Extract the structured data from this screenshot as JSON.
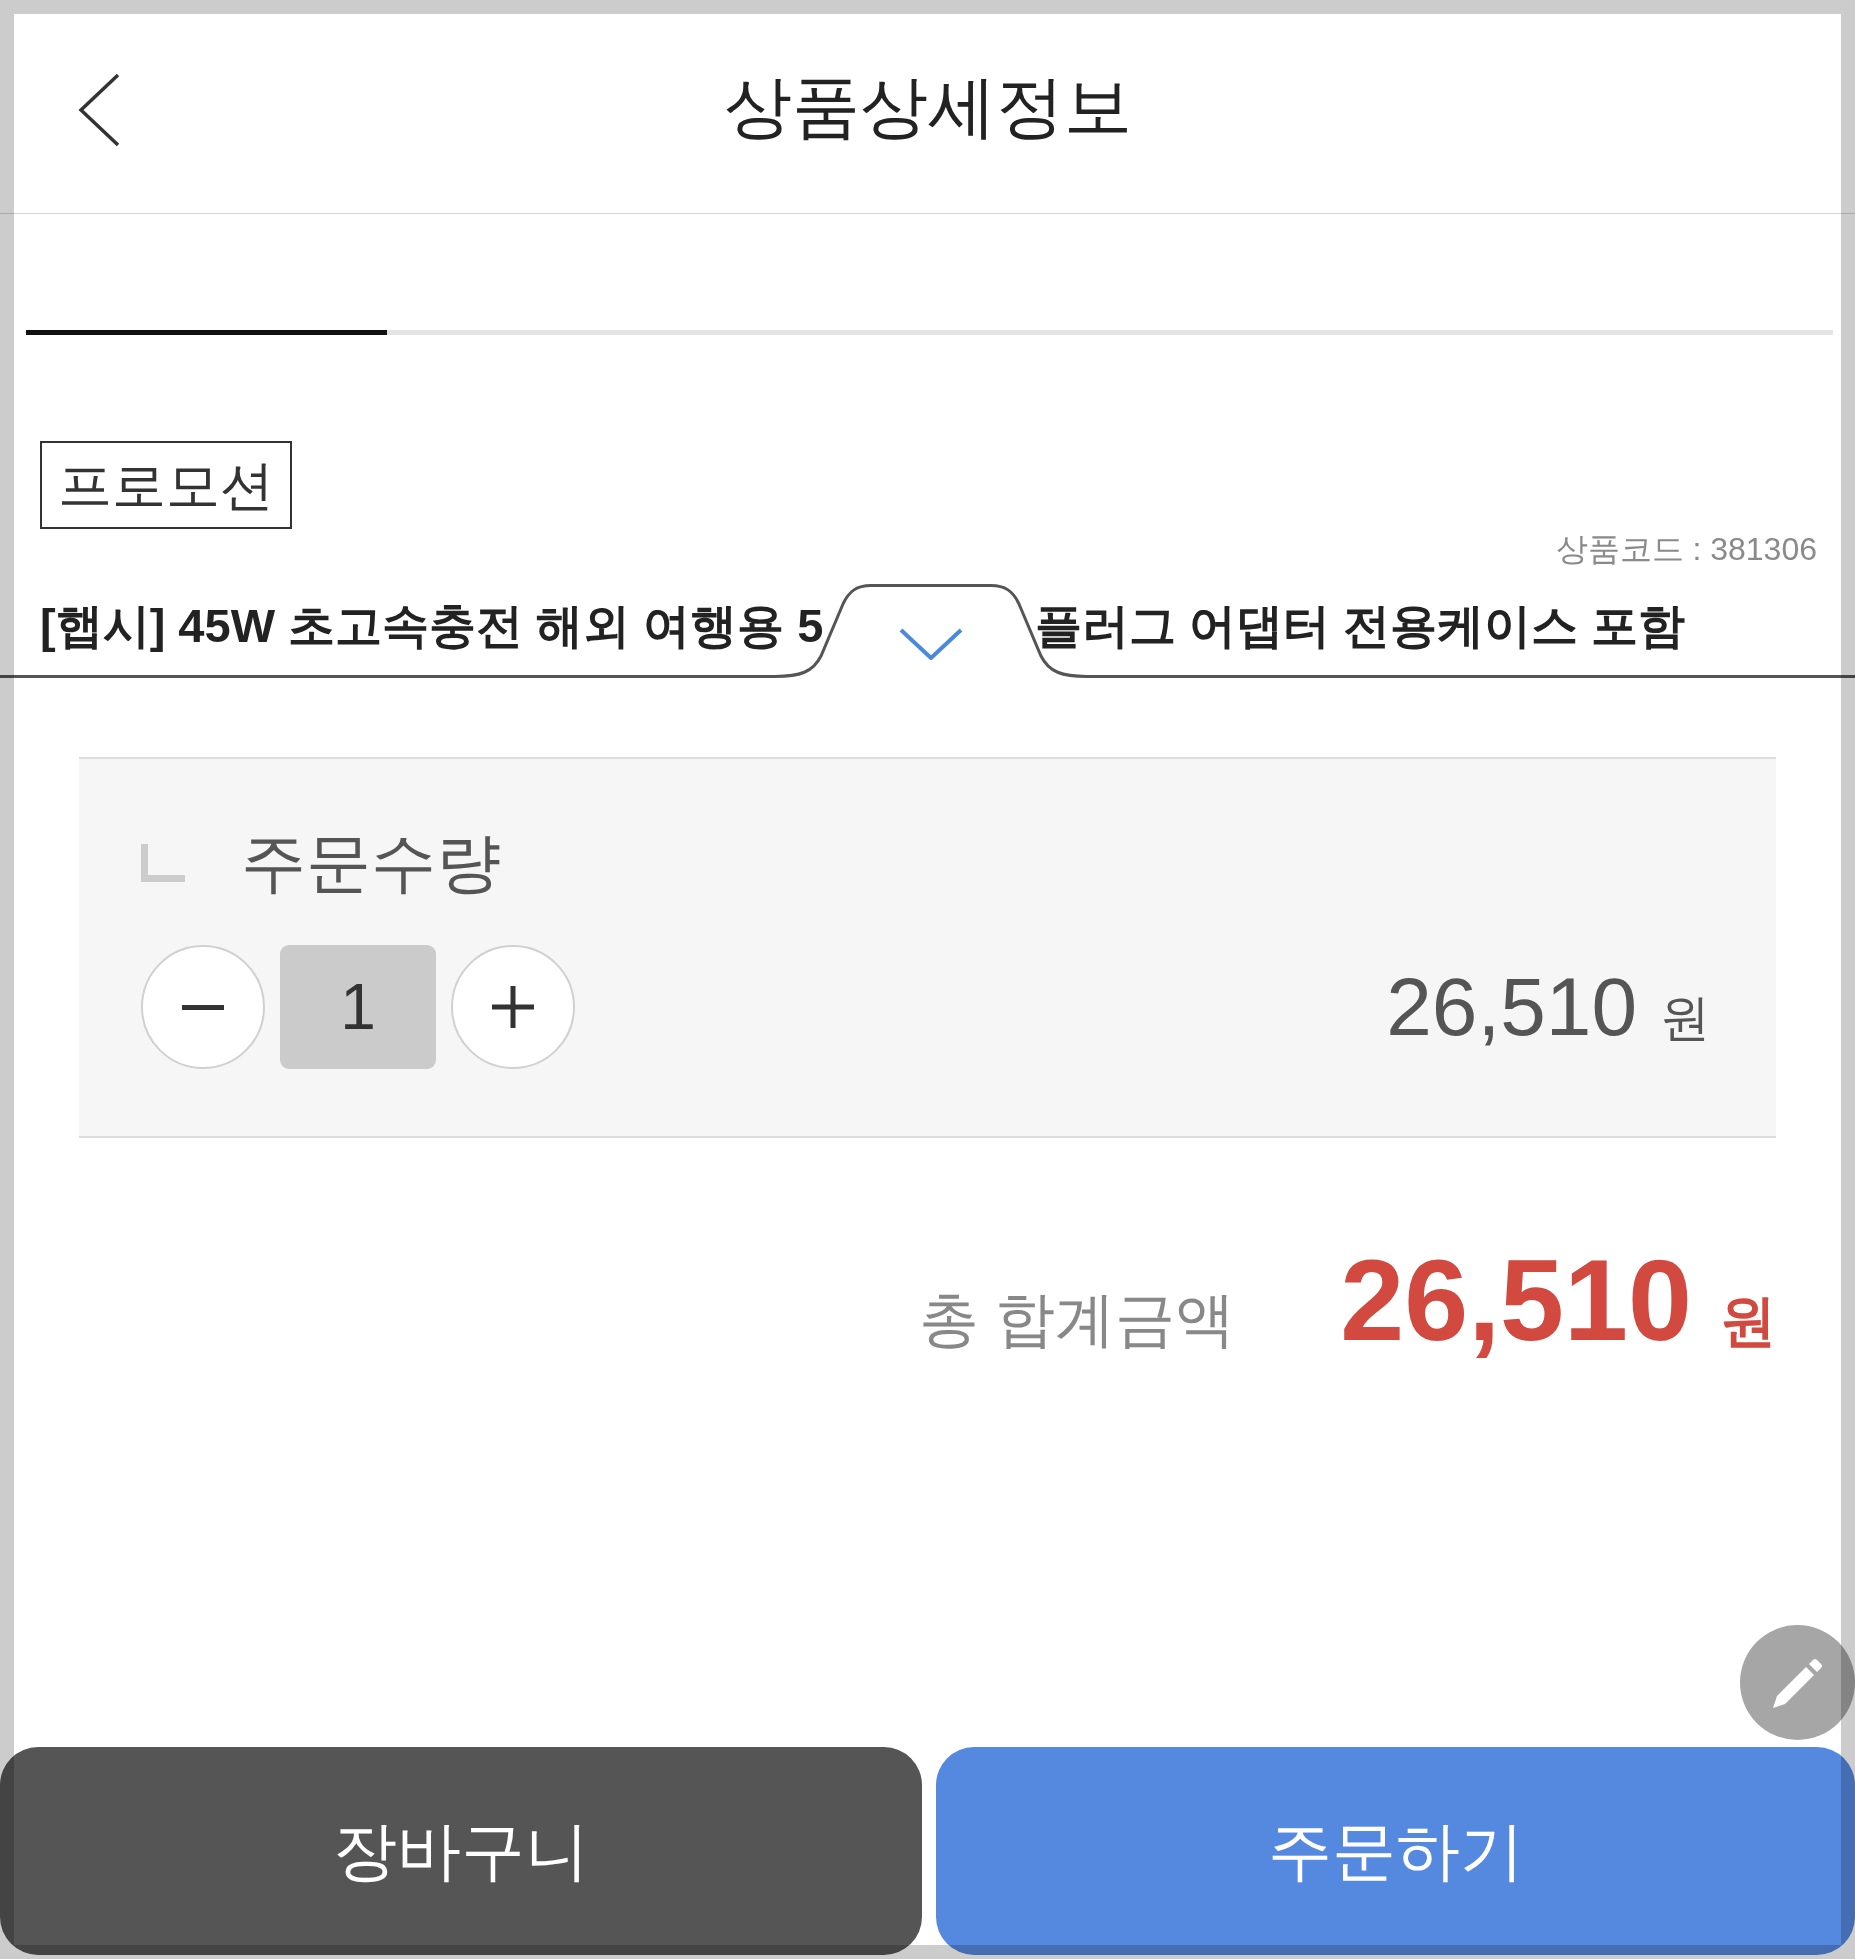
{
  "header": {
    "title": "상품상세정보"
  },
  "product": {
    "badge": "프로모션",
    "code": "상품코드 : 381306",
    "name_visible_parts": [
      "[햅시] 45W 초고속충전 해외 여행용 5",
      "플러그 어댑터 전용케이스 포함"
    ]
  },
  "option_sheet": {
    "expanded": true,
    "quantity_label": "주문수량",
    "quantity": "1",
    "line_price": "26,510",
    "line_currency": "원",
    "total_label": "총 합계금액",
    "total_price": "26,510",
    "total_currency": "원"
  },
  "buttons": [
    {
      "kind": "cart",
      "label": "장바구니"
    },
    {
      "kind": "order",
      "label": "주문하기"
    }
  ]
}
